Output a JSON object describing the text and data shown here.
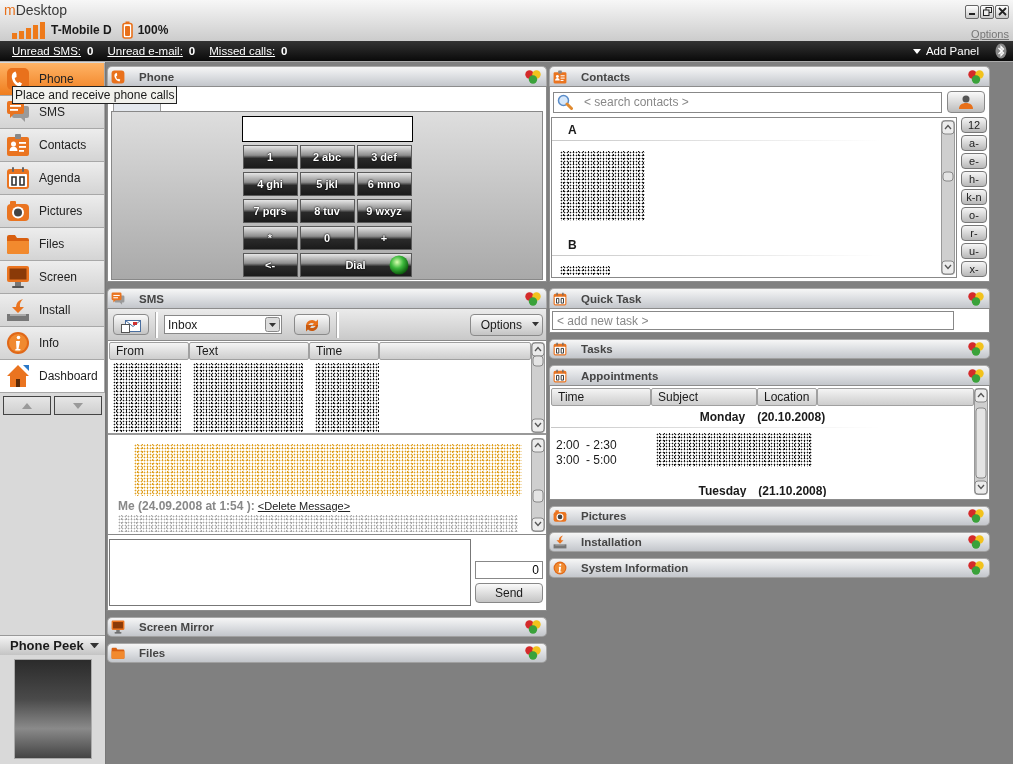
{
  "window": {
    "title_prefix": "m",
    "title": "Desktop",
    "options_link": "Options"
  },
  "device_status": {
    "carrier": "T-Mobile D",
    "battery": "100%"
  },
  "notification_bar": {
    "counters": [
      {
        "label": "Unread SMS:",
        "value": "0"
      },
      {
        "label": "Unread e-mail:",
        "value": "0"
      },
      {
        "label": "Missed calls:",
        "value": "0"
      }
    ],
    "add_panel": "Add Panel"
  },
  "sidebar": {
    "items": [
      {
        "kind": "phone",
        "label": "Phone",
        "selected": false,
        "hovered": true
      },
      {
        "kind": "sms",
        "label": "SMS",
        "selected": false,
        "hovered": false
      },
      {
        "kind": "contacts",
        "label": "Contacts",
        "selected": false,
        "hovered": false
      },
      {
        "kind": "agenda",
        "label": "Agenda",
        "selected": false,
        "hovered": false
      },
      {
        "kind": "pictures",
        "label": "Pictures",
        "selected": false,
        "hovered": false
      },
      {
        "kind": "files",
        "label": "Files",
        "selected": false,
        "hovered": false
      },
      {
        "kind": "screen",
        "label": "Screen",
        "selected": false,
        "hovered": false
      },
      {
        "kind": "install",
        "label": "Install",
        "selected": false,
        "hovered": false
      },
      {
        "kind": "info",
        "label": "Info",
        "selected": false,
        "hovered": false
      },
      {
        "kind": "dashboard",
        "label": "Dashboard",
        "selected": true,
        "hovered": false
      }
    ],
    "peek_title": "Phone Peek"
  },
  "tooltip": "Place and receive phone calls",
  "dashboard": {
    "left_panels": [
      {
        "kind": "dialer",
        "title": "Phone",
        "expanded": true,
        "keys": [
          {
            "kind": "key",
            "label": "1"
          },
          {
            "kind": "key",
            "label": "2 abc"
          },
          {
            "kind": "key",
            "label": "3 def"
          },
          {
            "kind": "key",
            "label": "4 ghi"
          },
          {
            "kind": "key",
            "label": "5 jkl"
          },
          {
            "kind": "key",
            "label": "6 mno"
          },
          {
            "kind": "key",
            "label": "7 pqrs"
          },
          {
            "kind": "key",
            "label": "8 tuv"
          },
          {
            "kind": "key",
            "label": "9 wxyz"
          },
          {
            "kind": "key",
            "label": "*"
          },
          {
            "kind": "key",
            "label": "0"
          },
          {
            "kind": "key",
            "label": "+"
          },
          {
            "kind": "key",
            "label": "<-"
          },
          {
            "kind": "dial",
            "label": "Dial"
          }
        ]
      },
      {
        "kind": "sms",
        "title": "SMS",
        "expanded": true,
        "folder": "Inbox",
        "options": "Options",
        "columns": [
          "From",
          "Text",
          "Time"
        ],
        "message_header": "Me (24.09.2008 at 1:54 ):",
        "delete_link": "<Delete Message>",
        "char_count": "0",
        "send": "Send"
      },
      {
        "kind": "screen_mirror",
        "title": "Screen Mirror",
        "expanded": false
      },
      {
        "kind": "files",
        "title": "Files",
        "expanded": false
      }
    ],
    "right_panels": [
      {
        "kind": "contacts",
        "title": "Contacts",
        "expanded": true,
        "search_placeholder": "< search contacts >",
        "sections": [
          "A",
          "B"
        ],
        "index": [
          "12",
          "a-",
          "e-",
          "h-",
          "k-n",
          "o-",
          "r-",
          "u-",
          "x-"
        ]
      },
      {
        "kind": "quick_task",
        "title": "Quick Task",
        "expanded": true,
        "placeholder": "< add new task >"
      },
      {
        "kind": "tasks",
        "title": "Tasks",
        "expanded": false
      },
      {
        "kind": "appointments",
        "title": "Appointments",
        "expanded": true,
        "columns": [
          "Time",
          "Subject",
          "Location"
        ],
        "days": [
          {
            "day": "Monday",
            "date": "(20.10.2008)",
            "entries": [
              "2:00  - 2:30",
              "3:00  - 5:00"
            ]
          },
          {
            "day": "Tuesday",
            "date": "(21.10.2008)"
          }
        ]
      },
      {
        "kind": "pictures",
        "title": "Pictures",
        "expanded": false
      },
      {
        "kind": "installation",
        "title": "Installation",
        "expanded": false
      },
      {
        "kind": "system_info",
        "title": "System Information",
        "expanded": false
      }
    ]
  }
}
